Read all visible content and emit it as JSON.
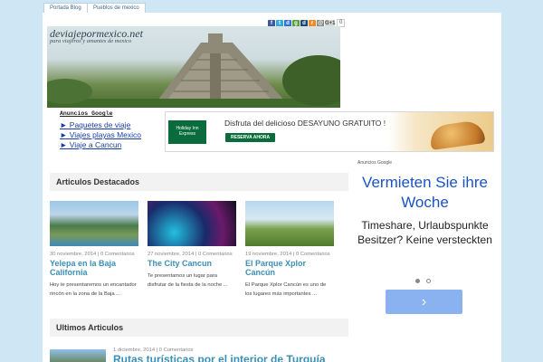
{
  "nav": {
    "tabs": [
      {
        "label": "Portada Blog"
      },
      {
        "label": "Pueblos de mexico"
      }
    ]
  },
  "social": {
    "icons": [
      "facebook-icon",
      "twitter-icon",
      "delicious-icon",
      "google-icon",
      "digg-icon",
      "rss-icon",
      "email-icon",
      "google-plus-icon"
    ],
    "plus_label": "G+1",
    "count": "0"
  },
  "header": {
    "site_title": "deviajepormexico.net",
    "subtitle": "para viajeros y amantes de mexico"
  },
  "ad_links": {
    "header": "Anuncios Google",
    "items": [
      {
        "label": "► Paquetes de viaje"
      },
      {
        "label": "► Viajes playas Mexico"
      },
      {
        "label": "► Viaje a Cancun"
      }
    ]
  },
  "banner_ad": {
    "logo_text": "Holiday Inn Express",
    "headline": "Disfruta del delicioso DESAYUNO GRATUITO !",
    "button": "RESERVA AHORA"
  },
  "featured": {
    "title": "Articulos Destacados",
    "posts": [
      {
        "date": "30 noviembre, 2014 | 0 Comentarios",
        "title": "Yelepa en la Baja California",
        "excerpt": "Hoy te presentaremos un encantador rincón en la zona de la Baja ..."
      },
      {
        "date": "27 noviembre, 2014 | 0 Comentarios",
        "title": "The City Cancun",
        "excerpt": "Te presentamos un lugar para disfrutar de la fiesta de la noche ..."
      },
      {
        "date": "19 noviembre, 2014 | 0 Comentarios",
        "title": "El Parque Xplor Cancún",
        "excerpt": "El Parque Xplor Cancún es uno de los lugares más importantes ..."
      }
    ]
  },
  "latest": {
    "title": "Ultimos Articulos",
    "post": {
      "date": "1 diciembre, 2014 | 0 Comentarios",
      "title": "Rutas turísticas por el interior de Turquía"
    }
  },
  "sidebar_ad": {
    "label": "Anuncios Google",
    "headline": "Vermieten Sie ihre Woche",
    "body": "Timeshare, Urlaubspunkte Besitzer? Keine versteckten",
    "button": "›"
  },
  "colors": {
    "accent": "#3a8fb5",
    "link": "#1a3ea8",
    "background": "#cfe7f4"
  }
}
